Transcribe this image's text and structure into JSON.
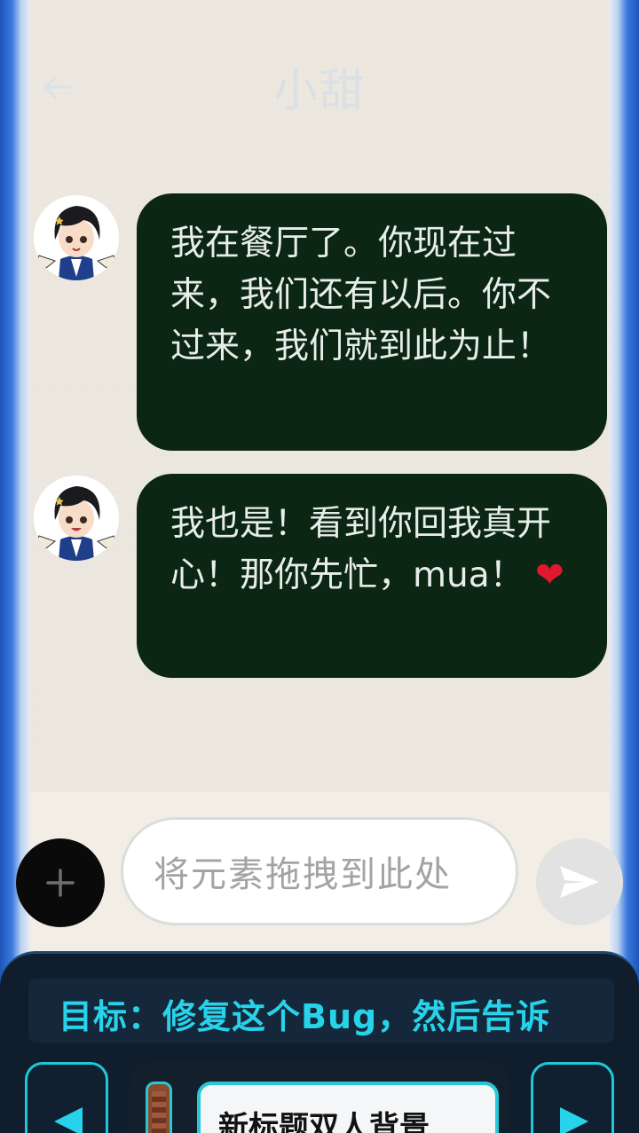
{
  "chat": {
    "title": "小甜",
    "messages": [
      {
        "sender": "contact",
        "text": "我在餐厅了。你现在过来，我们还有以后。你不过来，我们就到此为止！",
        "emoji": ""
      },
      {
        "sender": "contact",
        "text": "我也是！看到你回我真开心！那你先忙，mua！",
        "emoji": "❤"
      }
    ]
  },
  "input": {
    "placeholder": "将元素拖拽到此处"
  },
  "hud": {
    "objective": "目标：修复这个Bug，然后告诉",
    "card_label": "新标题双人背景"
  },
  "icons": {
    "back": "back-arrow-icon",
    "add": "plus-icon",
    "send": "send-icon",
    "prev": "left-triangle-icon",
    "next": "right-triangle-icon"
  },
  "colors": {
    "bubble_bg": "#0b2612",
    "hud_accent": "#27d3ea",
    "frame_blue": "#2a66c8"
  }
}
